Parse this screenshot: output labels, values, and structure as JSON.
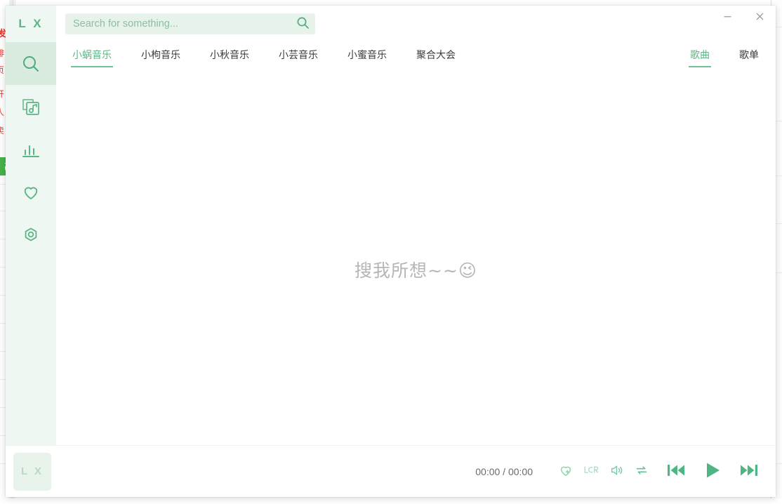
{
  "background": {
    "left_window": {
      "red_lines": [
        "发",
        "排",
        "页",
        "开",
        "人",
        "卖"
      ],
      "green_chip_label": "高"
    }
  },
  "app": {
    "logo": "L X",
    "window_controls": {
      "minimize": "minimize-button",
      "close": "close-button"
    }
  },
  "sidebar": {
    "items": [
      {
        "name": "search",
        "icon": "search-icon",
        "active": true
      },
      {
        "name": "music-library",
        "icon": "music-album-icon",
        "active": false
      },
      {
        "name": "leaderboard",
        "icon": "bar-chart-icon",
        "active": false
      },
      {
        "name": "favorites",
        "icon": "heart-icon",
        "active": false
      },
      {
        "name": "settings",
        "icon": "gear-icon",
        "active": false
      }
    ]
  },
  "search": {
    "value": "",
    "placeholder": "Search for something...",
    "icon": "search-icon"
  },
  "tabs": {
    "sources": [
      {
        "label": "小蜗音乐",
        "active": true
      },
      {
        "label": "小枸音乐",
        "active": false
      },
      {
        "label": "小秋音乐",
        "active": false
      },
      {
        "label": "小芸音乐",
        "active": false
      },
      {
        "label": "小蜜音乐",
        "active": false
      },
      {
        "label": "聚合大会",
        "active": false
      }
    ],
    "types": [
      {
        "label": "歌曲",
        "active": true
      },
      {
        "label": "歌单",
        "active": false
      }
    ]
  },
  "stage": {
    "empty_text": "搜我所想~~",
    "empty_emoji": "😉"
  },
  "player": {
    "album_placeholder": "L X",
    "time": "00:00 / 00:00",
    "current_time": "00:00",
    "total_time": "00:00",
    "buttons": {
      "like": "heart-plus-icon",
      "lyrics": "lrc-icon",
      "volume": "volume-icon",
      "repeat": "repeat-icon",
      "previous": "previous-track-icon",
      "play": "play-icon",
      "next": "next-track-icon"
    }
  },
  "colors": {
    "accent": "#5cb584",
    "accent_light": "#6ec195",
    "sidebar_bg": "#eef7f1",
    "sidebar_active": "#d9ecdf",
    "search_bg": "#e7f3ea",
    "player_icon": "#67bf92",
    "empty_text": "#b6b6b6"
  }
}
